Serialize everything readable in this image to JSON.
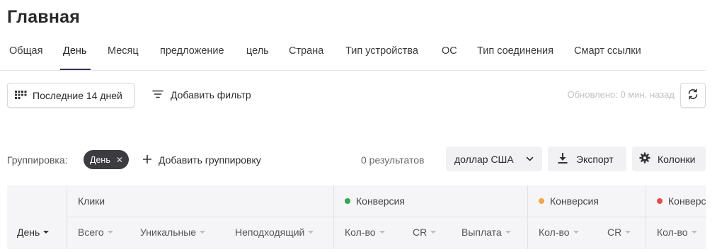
{
  "page": {
    "title": "Главная"
  },
  "tabs": [
    {
      "label": "Общая"
    },
    {
      "label": "День",
      "active": true
    },
    {
      "label": "Месяц"
    },
    {
      "label": "предложение"
    },
    {
      "label": "цель"
    },
    {
      "label": "Страна"
    },
    {
      "label": "Тип устройства"
    },
    {
      "label": "ОС"
    },
    {
      "label": "Тип соединения"
    },
    {
      "label": "Смарт ссылки"
    }
  ],
  "toolbar": {
    "date_range_label": "Последние 14 дней",
    "date_range_icon": "grid-dots-icon",
    "add_filter_label": "Добавить фильтр",
    "add_filter_icon": "filter-lines-icon",
    "updated_text": "Обновлено: 0 мин. назад",
    "refresh_icon": "refresh-icon"
  },
  "grouping": {
    "label": "Группировка:",
    "chips": [
      {
        "label": "День",
        "remove_icon": "close-icon"
      }
    ],
    "add_label": "Добавить группировку",
    "results_text": "0 результатов",
    "currency_value": "доллар США",
    "export_label": "Экспорт",
    "columns_label": "Колонки"
  },
  "colors": {
    "tab_active_underline": "#3a2f55",
    "chip_bg": "#3b3b40",
    "conversion_green": "#2eaa4f",
    "conversion_orange": "#f0a64a",
    "conversion_red": "#e84c4c",
    "updated_text": "#c2c2c2"
  },
  "table": {
    "row_header": "День",
    "groups": [
      {
        "title": "Клики",
        "dot_color": null,
        "columns": [
          "Всего",
          "Уникальные",
          "Неподходящий"
        ]
      },
      {
        "title": "Конверсия",
        "dot_color": "#2eaa4f",
        "columns": [
          "Кол-во",
          "CR",
          "Выплата"
        ]
      },
      {
        "title": "Конверсия",
        "dot_color": "#f0a64a",
        "columns": [
          "Кол-во",
          "CR"
        ]
      },
      {
        "title": "Конверсия",
        "dot_color": "#e84c4c",
        "columns": [
          "Кол-во"
        ]
      }
    ]
  }
}
